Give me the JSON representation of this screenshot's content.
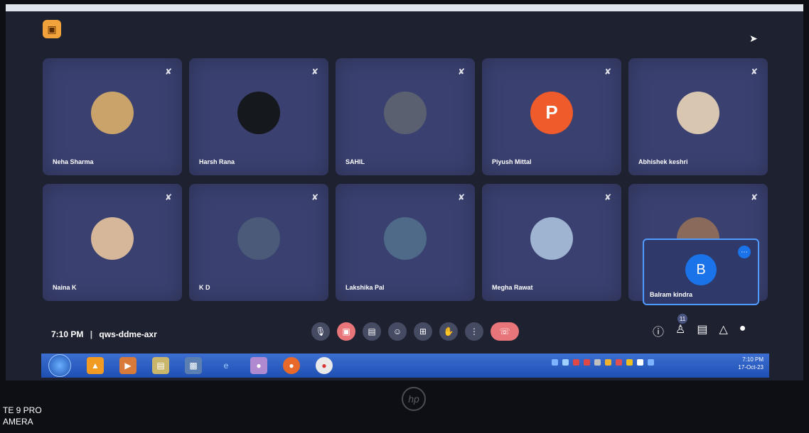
{
  "participants": [
    {
      "name": "Neha Sharma",
      "color": "#c9a36a"
    },
    {
      "name": "Harsh Rana",
      "color": "#15181c"
    },
    {
      "name": "SAHIL",
      "color": "#5a6070"
    },
    {
      "name": "Piyush Mittal",
      "color": "#ef5b2b",
      "initial": "P"
    },
    {
      "name": "Abhishek keshri",
      "color": "#d8c6b0"
    },
    {
      "name": "Naina K",
      "color": "#d6b79a"
    },
    {
      "name": "K D",
      "color": "#4a5a78"
    },
    {
      "name": "Lakshika Pal",
      "color": "#4e6a88"
    },
    {
      "name": "Megha Rawat",
      "color": "#9fb4d0"
    },
    {
      "name": "",
      "color": "#8a6a5a"
    }
  ],
  "self_view": {
    "name": "Balram kindra",
    "initial": "B"
  },
  "meeting": {
    "time": "7:10 PM",
    "separator": "|",
    "code": "qws-ddme-axr"
  },
  "people_count": "11",
  "taskbar": {
    "time": "7:10 PM",
    "date": "17-Oct-23"
  },
  "watermark": {
    "line1": "TE 9 PRO",
    "line2": "AMERA"
  },
  "laptop_brand": "hp",
  "icons": {
    "mic": "mic-icon",
    "camera_off": "camera-off-icon",
    "captions": "captions-icon",
    "emoji": "emoji-icon",
    "present": "present-icon",
    "hand": "raise-hand-icon",
    "more": "more-vert-icon",
    "end": "end-call-icon",
    "info": "info-icon",
    "people": "people-icon",
    "chat": "chat-icon",
    "activities": "activities-icon",
    "lock": "host-controls-icon"
  }
}
